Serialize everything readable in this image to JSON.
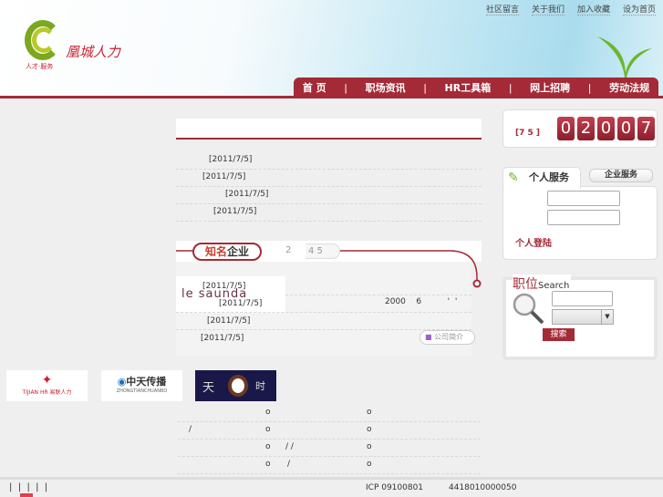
{
  "header": {
    "top_links": [
      "社区留言",
      "关于我们",
      "加入收藏",
      "设为首页"
    ],
    "logo_text": "凰城人力",
    "logo_sub": "人才·服务",
    "nav": [
      "首 页",
      "职场资讯",
      "HR工具箱",
      "网上招聘",
      "劳动法规"
    ]
  },
  "news": {
    "dates": [
      "[2011/7/5]",
      "[2011/7/5]",
      "[2011/7/5]",
      "[2011/7/5]"
    ]
  },
  "companies": {
    "title_red": "知名",
    "title_black": "企业",
    "pages": [
      "2",
      "4 5"
    ],
    "dates": [
      "[2011/7/5]",
      "[2011/7/5]",
      "[2011/7/5]",
      "[2011/7/5]"
    ],
    "logo": "le saunda",
    "info": "2000    6          '  '",
    "intro_button": "公司简介"
  },
  "counter": {
    "label": "[7 5 ]",
    "digits": [
      "0",
      "2",
      "0",
      "0",
      "7"
    ]
  },
  "service": {
    "tab_personal": "个人服务",
    "tab_company": "企业服务",
    "login": "个人登陆"
  },
  "search": {
    "title": "职位",
    "title_en": "Search",
    "button": "搜索"
  },
  "partners": [
    {
      "name": "TIJIAN HR 易联人力"
    },
    {
      "name": "中天传播",
      "sub": "ZHONGTIANCHUANBO"
    },
    {
      "name": "天",
      "right": "时"
    }
  ],
  "bottom_rows": [
    [
      "o",
      "o"
    ],
    [
      "/",
      "o",
      "o"
    ],
    [
      "o",
      "/ /",
      "o"
    ],
    [
      "o",
      "/",
      "o"
    ]
  ],
  "footer": {
    "links": "|  |  |  |  |",
    "icp": "ICP  09100801",
    "record": "4418010000050"
  }
}
